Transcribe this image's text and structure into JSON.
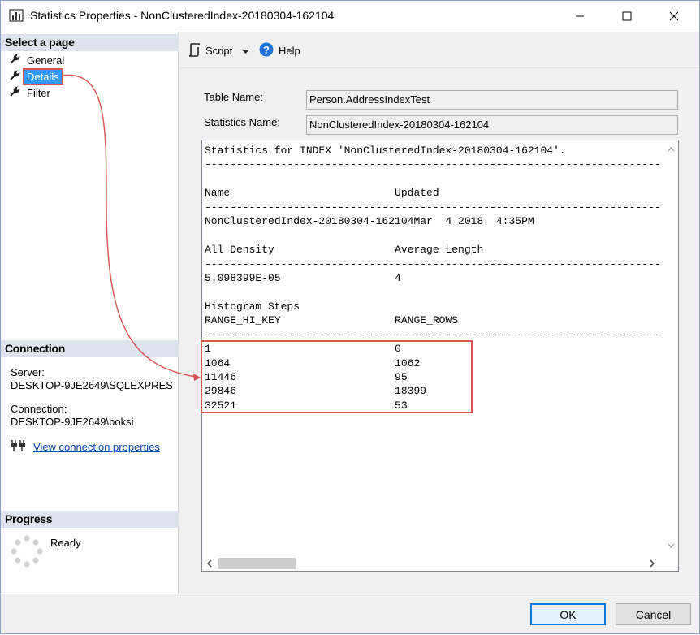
{
  "window": {
    "title": "Statistics Properties - NonClusteredIndex-20180304-162104"
  },
  "left": {
    "select_page_header": "Select a page",
    "pages": [
      {
        "label": "General",
        "selected": false
      },
      {
        "label": "Details",
        "selected": true
      },
      {
        "label": "Filter",
        "selected": false
      }
    ],
    "connection_header": "Connection",
    "server_label": "Server:",
    "server_value": "DESKTOP-9JE2649\\SQLEXPRES",
    "connection_label": "Connection:",
    "connection_value": "DESKTOP-9JE2649\\boksi",
    "view_connection_link": "View connection properties",
    "progress_header": "Progress",
    "progress_status": "Ready"
  },
  "toolbar": {
    "script_label": "Script",
    "help_label": "Help"
  },
  "form": {
    "table_name_label": "Table Name:",
    "table_name_value": "Person.AddressIndexTest",
    "statistics_name_label": "Statistics Name:",
    "statistics_name_value": "NonClusteredIndex-20180304-162104"
  },
  "output_lines": [
    "Statistics for INDEX 'NonClusteredIndex-20180304-162104'.",
    "----------------------------------------------------------------------------------------------------",
    "",
    "Name                          Updated",
    "----------------------------------------------------------------------------------------------------",
    "NonClusteredIndex-20180304-162104Mar  4 2018  4:35PM",
    "",
    "All Density                   Average Length",
    "----------------------------------------------------------------------------------------------------",
    "5.098399E-05                  4",
    "",
    "Histogram Steps",
    "RANGE_HI_KEY                  RANGE_ROWS",
    "----------------------------------------------------------------------------------------------------",
    "1                             0",
    "1064                          1062",
    "11446                         95",
    "29846                         18399",
    "32521                         53"
  ],
  "buttons": {
    "ok": "OK",
    "cancel": "Cancel"
  },
  "colors": {
    "accent": "#3399ff",
    "callout": "#d9534f",
    "link": "#0645ad",
    "header_bg": "#dde4ee"
  }
}
